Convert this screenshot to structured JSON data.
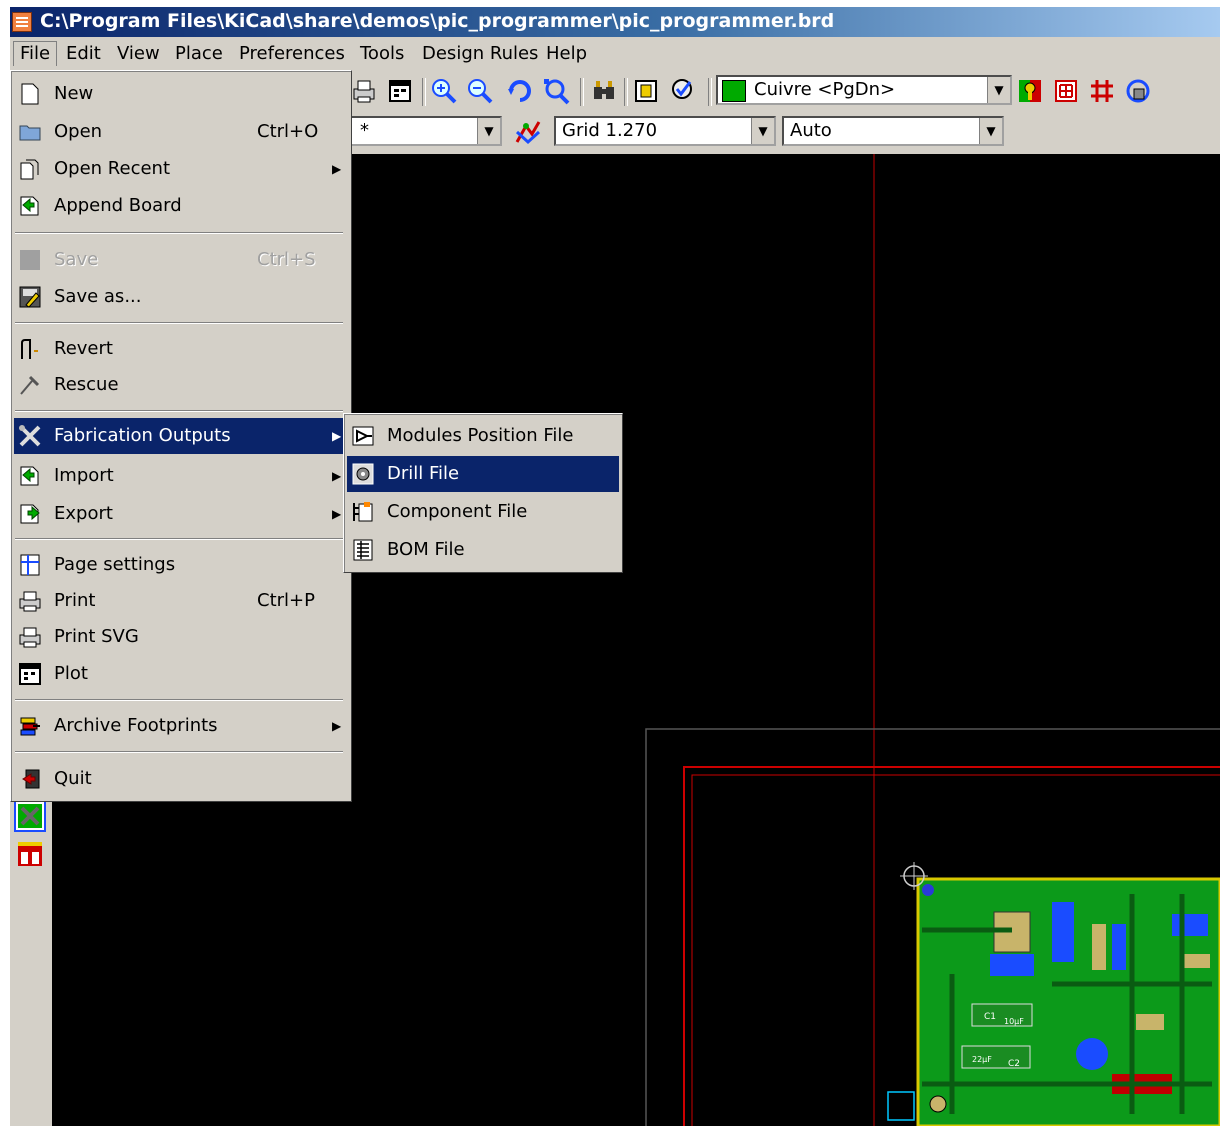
{
  "window": {
    "title": "C:\\Program Files\\KiCad\\share\\demos\\pic_programmer\\pic_programmer.brd"
  },
  "menubar": [
    "File",
    "Edit",
    "View",
    "Place",
    "Preferences",
    "Tools",
    "Design Rules",
    "Help"
  ],
  "toolbar": {
    "layer_combo": "Cuivre <PgDn>",
    "net_combo": "*",
    "grid_combo": "Grid 1.270",
    "zoom_combo": "Auto"
  },
  "file_menu": {
    "new": "New",
    "open": "Open",
    "open_accel": "Ctrl+O",
    "open_recent": "Open Recent",
    "append_board": "Append Board",
    "save": "Save",
    "save_accel": "Ctrl+S",
    "save_as": "Save as...",
    "revert": "Revert",
    "rescue": "Rescue",
    "fabrication_outputs": "Fabrication Outputs",
    "import": "Import",
    "export": "Export",
    "page_settings": "Page settings",
    "print": "Print",
    "print_accel": "Ctrl+P",
    "print_svg": "Print SVG",
    "plot": "Plot",
    "archive_footprints": "Archive Footprints",
    "quit": "Quit"
  },
  "fab_submenu": {
    "modules_position": "Modules Position File",
    "drill_file": "Drill File",
    "component_file": "Component File",
    "bom_file": "BOM File"
  },
  "pcb_labels": {
    "cap1": "C1",
    "cap1_value": "10µF",
    "cap2": "C2",
    "cap2_value": "22µF"
  },
  "colors": {
    "menu_bg": "#d4d0c8",
    "selection": "#0a246a",
    "canvas": "#000000",
    "pcb_green": "#0c9a1a",
    "board_edge": "#cc0000"
  }
}
